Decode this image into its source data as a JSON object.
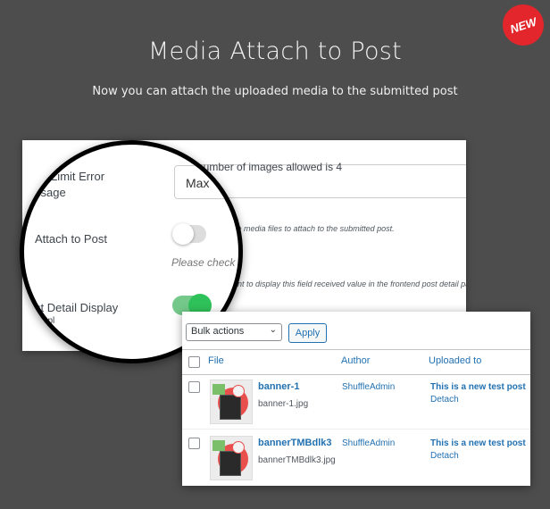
{
  "header": {
    "title": "Media Attach to Post",
    "subtitle": "Now you can attach the uploaded media to the submitted post",
    "badge": "NEW",
    "badge_color": "#e3262b"
  },
  "settings_panel": {
    "upload_label_partial": "Upload l",
    "message_label_partial": "Message",
    "limit_text_partial": "number of images allowed is 4",
    "attach_desc_partial": "the media files to attach to the submitted post.",
    "detail_desc_partial": "nt to display this field received value in the frontend post detail page."
  },
  "magnifier": {
    "upload_limit_label": "Upload Limit Error Message",
    "limit_label_line1": "Upload l",
    "limit_label_line2": "ad Limit Error",
    "limit_label_line3": "ssage",
    "input_value": "Max",
    "attach_label": "Attach to Post",
    "attach_toggle": "off",
    "please_check": "Please check",
    "detail_label": "st Detail Display",
    "detail_sub": "Displ",
    "detail_toggle": "on",
    "toggle_on_color": "#30c25a"
  },
  "media_panel": {
    "bulk_select": "Bulk actions",
    "apply_label": "Apply",
    "columns": [
      "File",
      "Author",
      "Uploaded to"
    ],
    "rows": [
      {
        "name": "banner-1",
        "file": "banner-1.jpg",
        "author": "ShuffleAdmin",
        "uploaded_to": "This is a new test post",
        "action": "Detach"
      },
      {
        "name": "bannerTMBdlk3",
        "file": "bannerTMBdlk3.jpg",
        "author": "ShuffleAdmin",
        "uploaded_to": "This is a new test post",
        "action": "Detach"
      }
    ],
    "link_color": "#2271b1"
  }
}
